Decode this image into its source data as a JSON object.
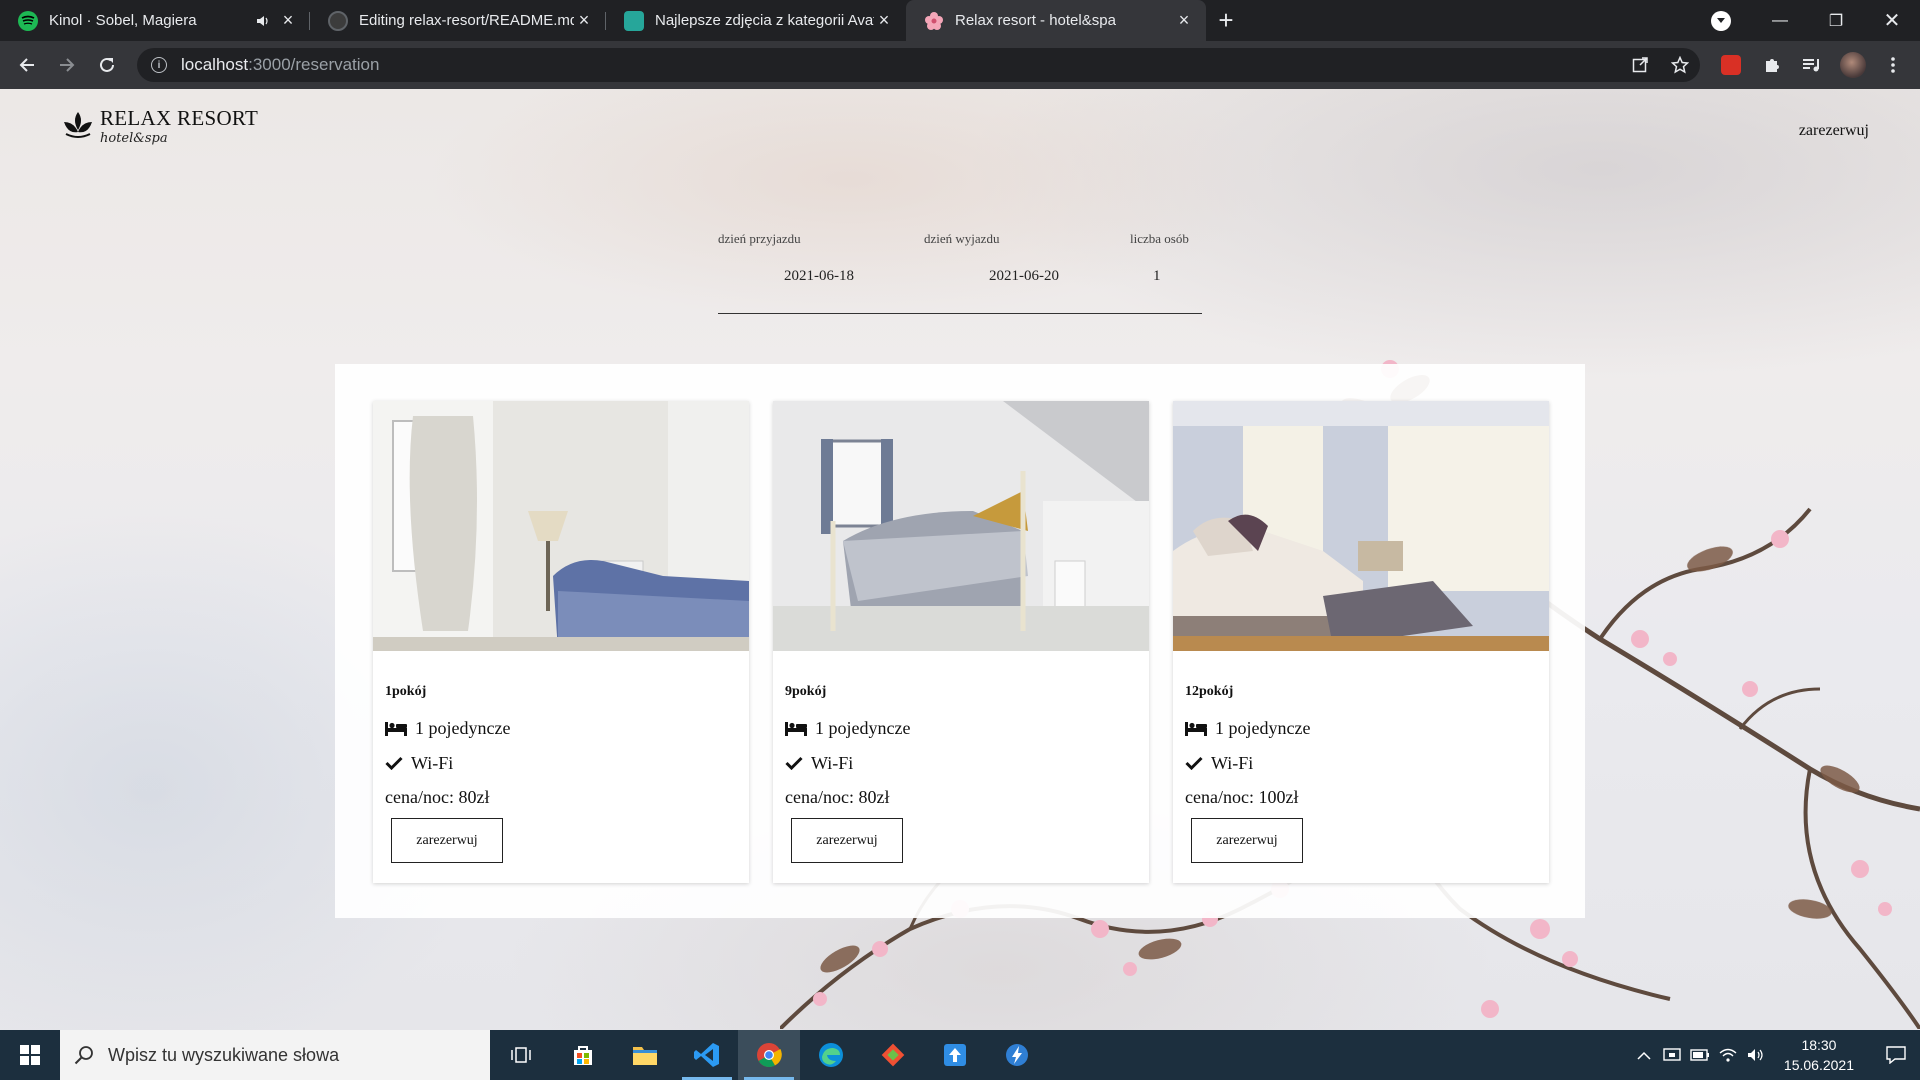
{
  "browser": {
    "tabs": [
      {
        "title": "Kinol · Sobel, Magiera",
        "active": false,
        "audio": true
      },
      {
        "title": "Editing relax-resort/README.md",
        "active": false
      },
      {
        "title": "Najlepsze zdjęcia z kategorii Avat",
        "active": false
      },
      {
        "title": "Relax resort - hotel&spa",
        "active": true
      }
    ],
    "url_host": "localhost",
    "url_path": ":3000/reservation"
  },
  "site": {
    "brand_title": "RELAX RESORT",
    "brand_subtitle": "hotel&spa",
    "nav_reserve": "zarezerwuj"
  },
  "search": {
    "arrival_label": "dzień przyjazdu",
    "departure_label": "dzień wyjazdu",
    "guests_label": "liczba osób",
    "arrival_value": "2021-06-18",
    "departure_value": "2021-06-20",
    "guests_value": "1"
  },
  "rooms": [
    {
      "name": "1pokój",
      "beds": "1 pojedyncze",
      "amenity": "Wi-Fi",
      "price": "cena/noc: 80zł",
      "button": "zarezerwuj"
    },
    {
      "name": "9pokój",
      "beds": "1 pojedyncze",
      "amenity": "Wi-Fi",
      "price": "cena/noc: 80zł",
      "button": "zarezerwuj"
    },
    {
      "name": "12pokój",
      "beds": "1 pojedyncze",
      "amenity": "Wi-Fi",
      "price": "cena/noc: 100zł",
      "button": "zarezerwuj"
    }
  ],
  "taskbar": {
    "search_placeholder": "Wpisz tu wyszukiwane słowa",
    "time": "18:30",
    "date": "15.06.2021",
    "pinned": [
      "task-view-icon",
      "store-icon",
      "file-explorer-icon",
      "vscode-icon",
      "chrome-icon",
      "edge-icon",
      "git-icon",
      "upload-app-icon",
      "power-automate-icon"
    ]
  },
  "colors": {
    "chrome_dark": "#202124",
    "chrome_toolbar": "#35363a",
    "taskbar": "#1c2f3e",
    "spotify": "#1db954",
    "accent_blue": "#0078d7"
  }
}
